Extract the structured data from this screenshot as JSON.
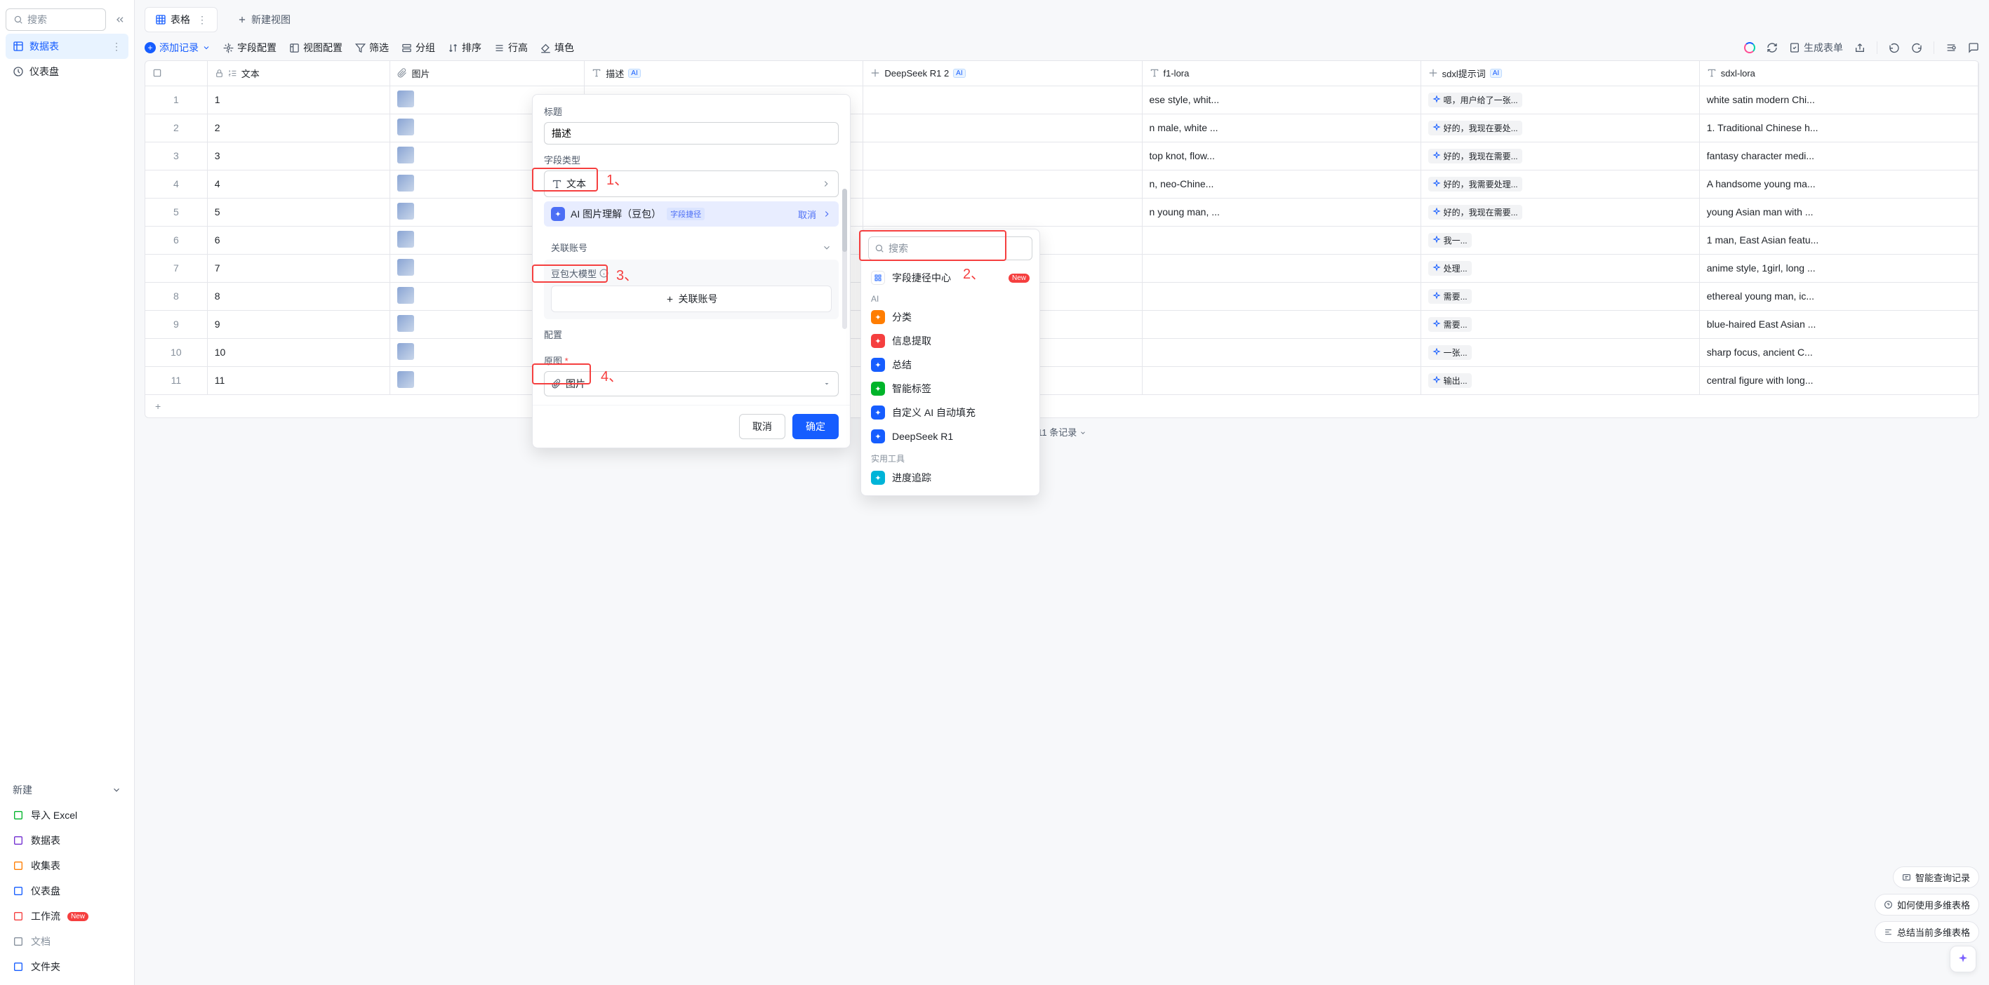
{
  "sidebar": {
    "search_placeholder": "搜索",
    "nav": [
      {
        "label": "数据表",
        "active": true
      },
      {
        "label": "仪表盘",
        "active": false
      }
    ],
    "new_section_label": "新建",
    "new_items": [
      {
        "label": "导入 Excel",
        "color": "#00b42a"
      },
      {
        "label": "数据表",
        "color": "#722ed1"
      },
      {
        "label": "收集表",
        "color": "#ff7d00"
      },
      {
        "label": "仪表盘",
        "color": "#165dff"
      },
      {
        "label": "工作流",
        "color": "#f53f3f",
        "badge": "New"
      },
      {
        "label": "文档",
        "color": "#86909c",
        "muted": true
      },
      {
        "label": "文件夹",
        "color": "#165dff"
      }
    ]
  },
  "tabs": {
    "table": "表格",
    "new_view": "新建视图"
  },
  "toolbar": {
    "add_record": "添加记录",
    "field_config": "字段配置",
    "view_config": "视图配置",
    "filter": "筛选",
    "group": "分组",
    "sort": "排序",
    "row_height": "行高",
    "fill": "填色",
    "gen_form": "生成表单"
  },
  "columns": {
    "text": "文本",
    "image": "图片",
    "desc": "描述",
    "deepseek": "DeepSeek R1 2",
    "f1lora": "f1-lora",
    "sdxl_prompt": "sdxl提示词",
    "sdxl_lora": "sdxl-lora"
  },
  "rows": [
    {
      "n": "1",
      "txt": "1",
      "f1": "ese style, whit...",
      "sdxl": "嗯，用户给了一张...",
      "lora": "white satin modern Chi..."
    },
    {
      "n": "2",
      "txt": "2",
      "f1": "n male, white ...",
      "sdxl": "好的，我现在要处...",
      "lora": "1. Traditional Chinese h..."
    },
    {
      "n": "3",
      "txt": "3",
      "f1": "top knot, flow...",
      "sdxl": "好的，我现在需要...",
      "lora": "fantasy character medi..."
    },
    {
      "n": "4",
      "txt": "4",
      "f1": "n, neo-Chine...",
      "sdxl": "好的，我需要处理...",
      "lora": "A handsome young ma..."
    },
    {
      "n": "5",
      "txt": "5",
      "f1": "n young man, ...",
      "sdxl": "好的，我现在需要...",
      "lora": "young Asian man with ..."
    },
    {
      "n": "6",
      "txt": "6",
      "f1": "",
      "sdxl": "我一...",
      "lora": "1 man, East Asian featu..."
    },
    {
      "n": "7",
      "txt": "7",
      "f1": "",
      "sdxl": "处理...",
      "lora": "anime style, 1girl, long ..."
    },
    {
      "n": "8",
      "txt": "8",
      "f1": "",
      "sdxl": "需要...",
      "lora": "ethereal young man, ic..."
    },
    {
      "n": "9",
      "txt": "9",
      "f1": "",
      "sdxl": "需要...",
      "lora": "blue-haired East Asian ..."
    },
    {
      "n": "10",
      "txt": "10",
      "f1": "",
      "sdxl": "一张...",
      "lora": "sharp focus, ancient C..."
    },
    {
      "n": "11",
      "txt": "11",
      "f1": "",
      "sdxl": "输出...",
      "lora": "central figure with long..."
    }
  ],
  "footer": {
    "record_count": "11 条记录"
  },
  "config_panel": {
    "title_label": "标题",
    "title_value": "描述",
    "field_type_label": "字段类型",
    "field_type_value": "文本",
    "ai_shortcut_name": "AI 图片理解（豆包）",
    "ai_shortcut_path": "字段捷径",
    "ai_shortcut_cancel": "取消",
    "account_label": "关联账号",
    "model_label": "豆包大模型",
    "link_account_btn": "关联账号",
    "config_label": "配置",
    "orig_image_label": "原图",
    "orig_image_value": "图片",
    "cancel_btn": "取消",
    "confirm_btn": "确定"
  },
  "annotations": {
    "a1": "1、",
    "a2": "2、",
    "a3": "3、",
    "a4": "4、"
  },
  "search_popup": {
    "placeholder": "搜索",
    "center": "字段捷径中心",
    "center_badge": "New",
    "cat_ai": "AI",
    "ai_items": [
      {
        "label": "分类",
        "color": "#ff7d00"
      },
      {
        "label": "信息提取",
        "color": "#f53f3f"
      },
      {
        "label": "总结",
        "color": "#165dff"
      },
      {
        "label": "智能标签",
        "color": "#00b42a"
      },
      {
        "label": "自定义 AI 自动填充",
        "color": "#165dff"
      },
      {
        "label": "DeepSeek R1",
        "color": "#165dff"
      }
    ],
    "cat_util": "实用工具",
    "util_items": [
      {
        "label": "进度追踪",
        "color": "#00b4d8"
      }
    ]
  },
  "help_chips": {
    "c1": "智能查询记录",
    "c2": "如何使用多维表格",
    "c3": "总结当前多维表格"
  }
}
